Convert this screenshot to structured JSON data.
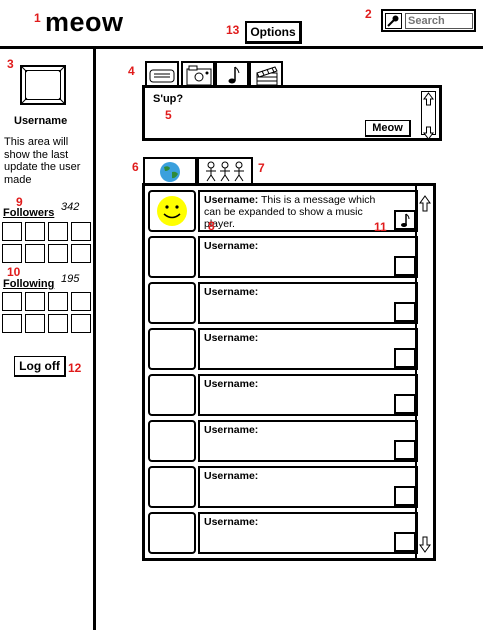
{
  "header": {
    "app_title": "meow",
    "options_label": "Options",
    "search_placeholder": "Search"
  },
  "sidebar": {
    "username": "Username",
    "status_text": "This area will show the last update the user made",
    "followers_label": "Followers",
    "followers_count": "342",
    "following_label": "Following",
    "following_count": "195",
    "logoff_label": "Log off"
  },
  "compose": {
    "text": "S'up?",
    "submit_label": "Meow",
    "tabs": [
      "keyboard-icon",
      "camera-icon",
      "music-note-icon",
      "clapperboard-icon"
    ]
  },
  "feed": {
    "tabs": [
      "globe-icon",
      "friends-icon"
    ],
    "items": [
      {
        "user": "Username:",
        "message": "This is a message which can be expanded to show a music player."
      },
      {
        "user": "Username:",
        "message": ""
      },
      {
        "user": "Username:",
        "message": ""
      },
      {
        "user": "Username:",
        "message": ""
      },
      {
        "user": "Username:",
        "message": ""
      },
      {
        "user": "Username:",
        "message": ""
      },
      {
        "user": "Username:",
        "message": ""
      },
      {
        "user": "Username:",
        "message": ""
      }
    ]
  },
  "callouts": [
    "1",
    "2",
    "3",
    "4",
    "5",
    "6",
    "7",
    "8",
    "9",
    "10",
    "11",
    "12",
    "13"
  ],
  "colors": {
    "callout": "#e01b1b",
    "smiley": "#ffff00",
    "globe_sea": "#3aa0dd",
    "globe_land": "#2e8b3a"
  }
}
